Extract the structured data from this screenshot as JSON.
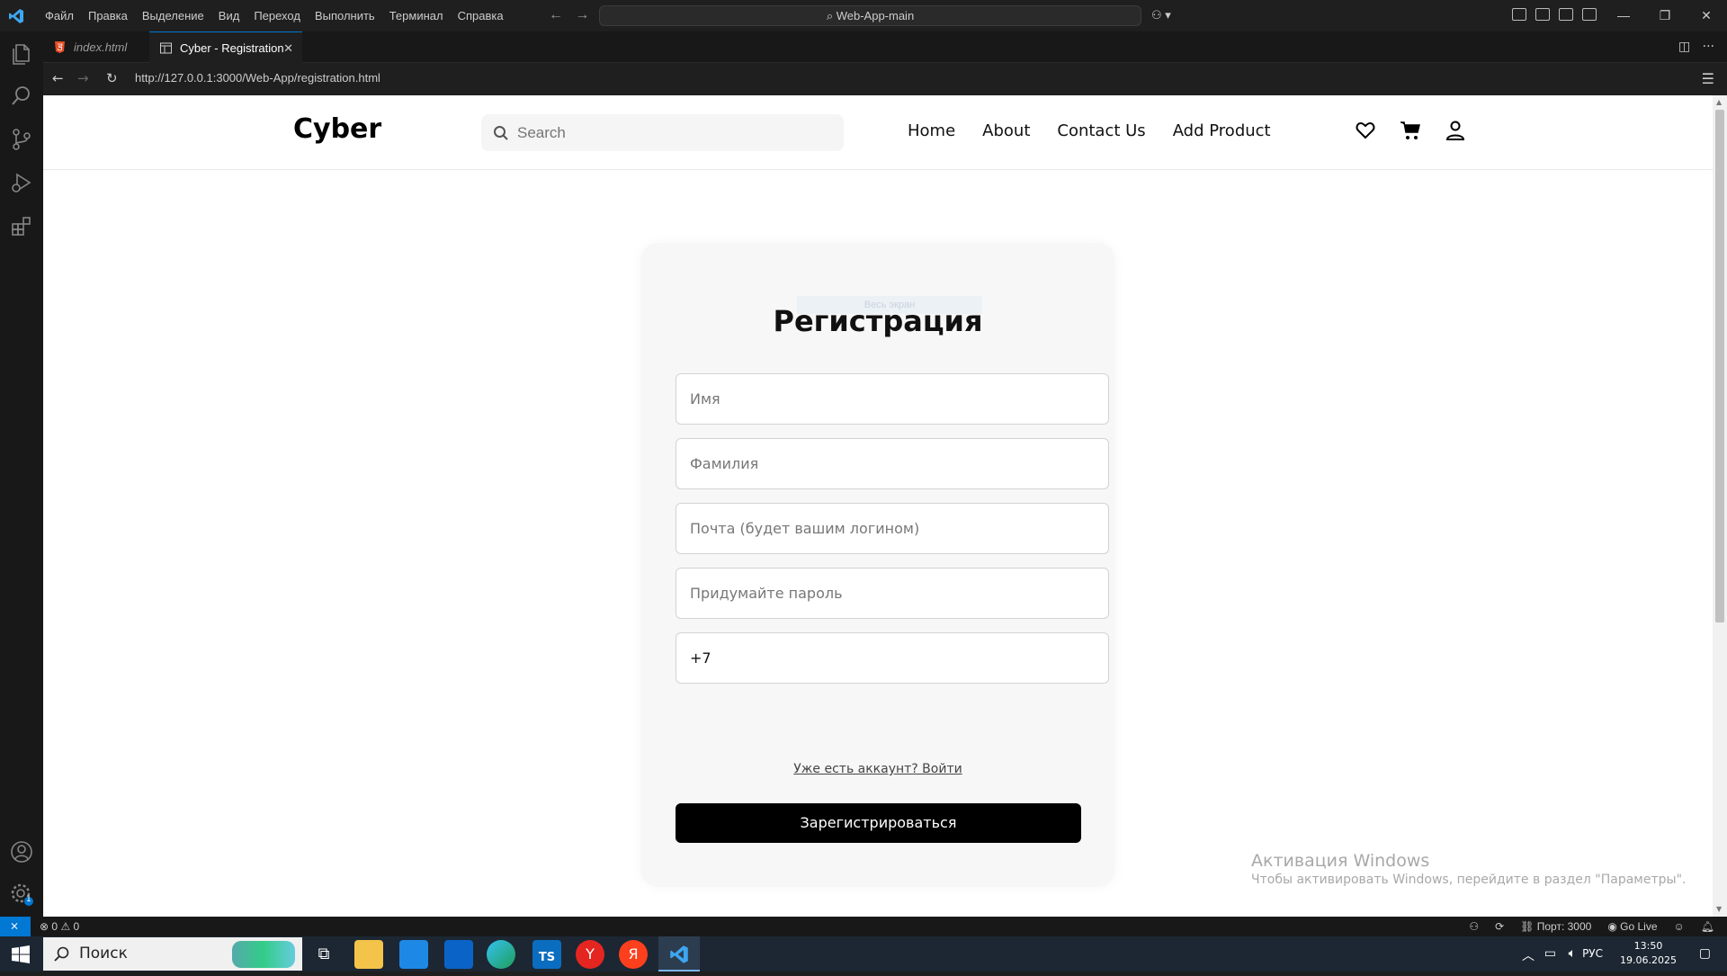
{
  "titlebar": {
    "menus": [
      "Файл",
      "Правка",
      "Выделение",
      "Вид",
      "Переход",
      "Выполнить",
      "Терминал",
      "Справка"
    ],
    "command_center": "Web-App-main"
  },
  "tabs": [
    {
      "label": "index.html"
    },
    {
      "label": "Cyber - Registration"
    }
  ],
  "browser": {
    "url": "http://127.0.0.1:3000/Web-App/registration.html"
  },
  "site": {
    "brand": "Cyber",
    "search_placeholder": "Search",
    "nav": [
      "Home",
      "About",
      "Contact Us",
      "Add Product"
    ]
  },
  "form": {
    "ghost_label": "Весь экран",
    "title": "Регистрация",
    "fields": [
      {
        "placeholder": "Имя"
      },
      {
        "placeholder": "Фамилия"
      },
      {
        "placeholder": "Почта (будет вашим логином)"
      },
      {
        "placeholder": "Придумайте пароль"
      },
      {
        "value": "+7"
      }
    ],
    "login_link": "Уже есть аккаунт? Войти",
    "submit": "Зарегистрироваться"
  },
  "activation": {
    "title": "Активация Windows",
    "subtitle": "Чтобы активировать Windows, перейдите в раздел \"Параметры\"."
  },
  "statusbar": {
    "problems": "0",
    "warnings": "0",
    "port": "Порт: 3000",
    "golive": "Go Live",
    "badge": "1"
  },
  "taskbar": {
    "search": "Поиск",
    "lang": "РУС",
    "time": "13:50",
    "date": "19.06.2025"
  },
  "colors": {
    "vscode_blue": "#0078d4",
    "button_black": "#000000"
  }
}
